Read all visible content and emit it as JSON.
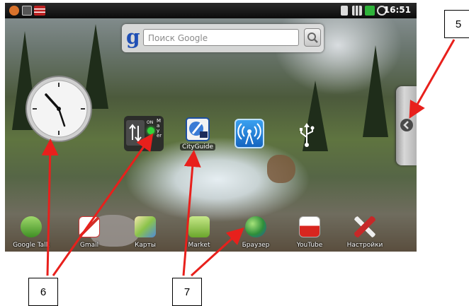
{
  "status_bar": {
    "time": "16:51"
  },
  "search_widget": {
    "logo": "g",
    "placeholder": "Поиск Google"
  },
  "widgets": {
    "cityguide_label": "CityGuide",
    "toggle_side_label": "Mayer",
    "toggle_state": "ON"
  },
  "dock": [
    {
      "label": "Google Talk",
      "icon": "talk-icon"
    },
    {
      "label": "Gmail",
      "icon": "gmail-icon"
    },
    {
      "label": "Карты",
      "icon": "maps-icon"
    },
    {
      "label": "Market",
      "icon": "market-icon"
    },
    {
      "label": "Браузер",
      "icon": "browser-icon"
    },
    {
      "label": "YouTube",
      "icon": "youtube-icon"
    },
    {
      "label": "Настройки",
      "icon": "settings-icon"
    }
  ],
  "callouts": {
    "c5": "5",
    "c6": "6",
    "c7": "7"
  },
  "colors": {
    "arrow": "#e8201c",
    "status_bar": "#111111",
    "google_blue": "#1f4fb5"
  }
}
